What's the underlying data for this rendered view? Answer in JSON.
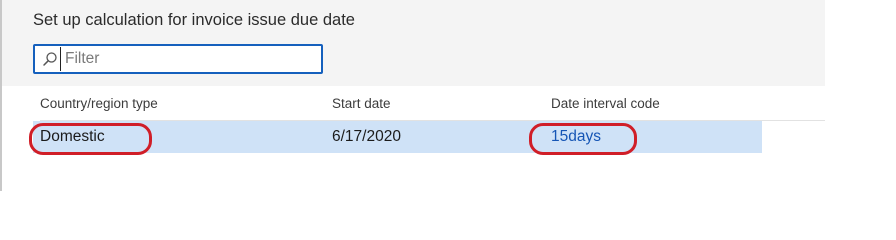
{
  "dialog": {
    "title": "Set up calculation for invoice issue due date"
  },
  "filter": {
    "placeholder": "Filter",
    "value": ""
  },
  "grid": {
    "columns": [
      {
        "label": "Country/region type"
      },
      {
        "label": "Start date"
      },
      {
        "label": "Date interval code"
      }
    ],
    "rows": [
      {
        "country_region_type": "Domestic",
        "start_date": "6/17/2020",
        "date_interval_code": "15days",
        "selected": true
      }
    ]
  },
  "annotations": {
    "highlight_color": "#d01e28",
    "highlighted_fields": [
      "country_region_type",
      "date_interval_code"
    ]
  },
  "colors": {
    "accent": "#1560bd",
    "selected_row": "#cfe2f7",
    "link_text": "#1555b5"
  }
}
